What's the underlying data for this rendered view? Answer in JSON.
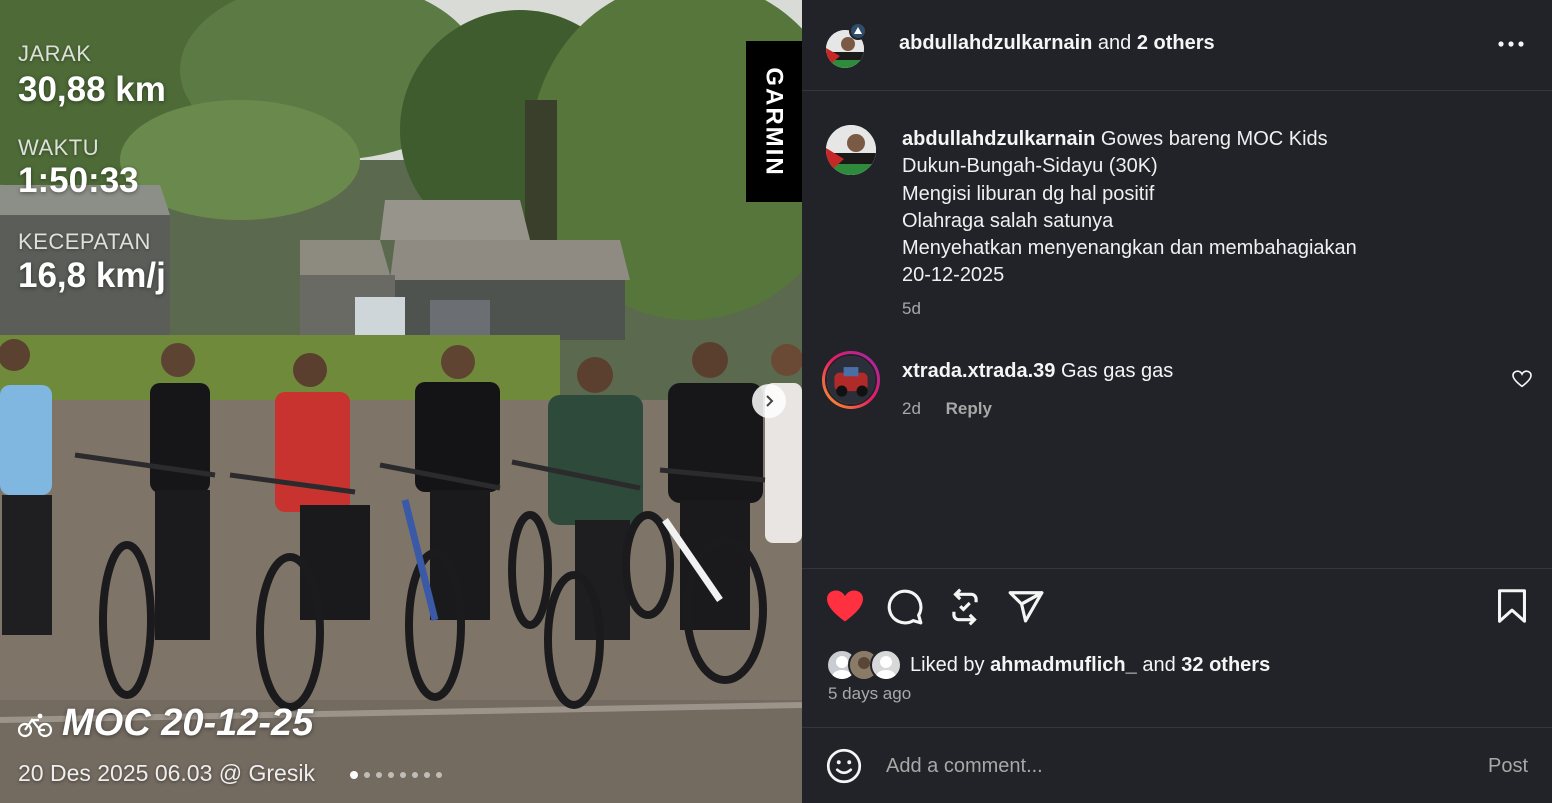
{
  "photo": {
    "stats": [
      {
        "label": "JARAK",
        "value": "30,88 km"
      },
      {
        "label": "WAKTU",
        "value": "1:50:33"
      },
      {
        "label": "KECEPATAN",
        "value": "16,8 km/j"
      }
    ],
    "brand": "GARMIN",
    "activity_title": "MOC 20-12-25",
    "activity_meta": "20 Des 2025 06.03 @ Gresik",
    "carousel": {
      "count": 8,
      "active_index": 0
    }
  },
  "header": {
    "username": "abdullahdzulkarnain",
    "collaborators_text": "and",
    "collaborators_count": "2 others"
  },
  "caption": {
    "username": "abdullahdzulkarnain",
    "first_line": "Gowes bareng MOC Kids",
    "lines": [
      "Dukun-Bungah-Sidayu (30K)",
      "Mengisi liburan dg hal positif",
      "Olahraga salah satunya",
      "Menyehatkan menyenangkan dan membahagiakan",
      "20-12-2025"
    ],
    "time": "5d"
  },
  "comments": [
    {
      "username": "xtrada.xtrada.39",
      "text": "Gas gas gas",
      "time": "2d",
      "reply_label": "Reply"
    }
  ],
  "likes": {
    "prefix": "Liked by",
    "first_liker": "ahmadmuflich_",
    "connector": "and",
    "others": "32 others",
    "liked_by_me": true,
    "like_color": "#ff3040"
  },
  "post_time": "5 days ago",
  "comment_box": {
    "placeholder": "Add a comment...",
    "post_label": "Post"
  },
  "icons": [
    "heart-icon",
    "comment-icon",
    "repost-icon",
    "share-icon",
    "bookmark-icon",
    "emoji-icon",
    "more-icon",
    "chevron-right-icon",
    "bike-icon"
  ]
}
